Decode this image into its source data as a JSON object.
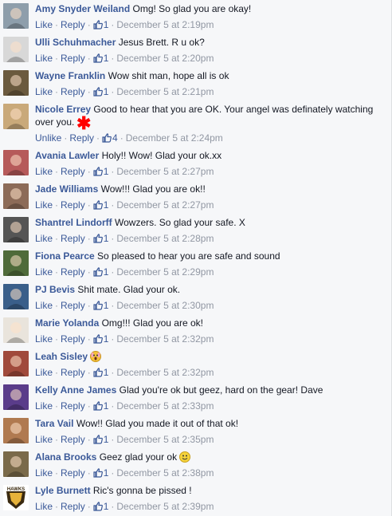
{
  "comments": [
    {
      "name": "Amy Snyder Weiland",
      "text": "Omg! So glad you are okay!",
      "like": "Like",
      "reply": "Reply",
      "likes": "1",
      "time": "December 5 at 2:19pm",
      "avatar_bg": "#8e9eab"
    },
    {
      "name": "Ulli Schuhmacher",
      "text": "Jesus Brett. R u ok?",
      "like": "Like",
      "reply": "Reply",
      "likes": "1",
      "time": "December 5 at 2:20pm",
      "avatar_bg": "#d8d8d8"
    },
    {
      "name": "Wayne Franklin",
      "text": "Wow shit man, hope all is ok",
      "like": "Like",
      "reply": "Reply",
      "likes": "1",
      "time": "December 5 at 2:21pm",
      "avatar_bg": "#6b5a3e"
    },
    {
      "name": "Nicole Errey",
      "text": "Good to hear that you are OK. Your angel was definately watching over you.",
      "like": "Unlike",
      "reply": "Reply",
      "likes": "4",
      "time": "December 5 at 2:24pm",
      "avatar_bg": "#c9a97a"
    },
    {
      "name": "Avania Lawler",
      "text": "Holy!! Wow! Glad your ok.xx",
      "like": "Like",
      "reply": "Reply",
      "likes": "1",
      "time": "December 5 at 2:27pm",
      "avatar_bg": "#b65a5a"
    },
    {
      "name": "Jade Williams",
      "text": "Wow!!! Glad you are ok!!",
      "like": "Like",
      "reply": "Reply",
      "likes": "1",
      "time": "December 5 at 2:27pm",
      "avatar_bg": "#8c6b58"
    },
    {
      "name": "Shantrel Lindorff",
      "text": "Wowzers. So glad your safe. X",
      "like": "Like",
      "reply": "Reply",
      "likes": "1",
      "time": "December 5 at 2:28pm",
      "avatar_bg": "#555555"
    },
    {
      "name": "Fiona Pearce",
      "text": "So pleased to hear you are safe and sound",
      "like": "Like",
      "reply": "Reply",
      "likes": "1",
      "time": "December 5 at 2:29pm",
      "avatar_bg": "#4f6b3a"
    },
    {
      "name": "PJ Bevis",
      "text": "Shit mate. Glad your ok.",
      "like": "Like",
      "reply": "Reply",
      "likes": "1",
      "time": "December 5 at 2:30pm",
      "avatar_bg": "#3a5f8a"
    },
    {
      "name": "Marie Yolanda",
      "text": "Omg!!! Glad you are ok!",
      "like": "Like",
      "reply": "Reply",
      "likes": "1",
      "time": "December 5 at 2:32pm",
      "avatar_bg": "#e9e4dc"
    },
    {
      "name": "Leah Sisley",
      "text": "",
      "like": "Like",
      "reply": "Reply",
      "likes": "1",
      "time": "December 5 at 2:32pm",
      "avatar_bg": "#a04a3c",
      "emoji": "scream"
    },
    {
      "name": "Kelly Anne James",
      "text": "Glad you're ok but geez, hard on the gear! Dave",
      "like": "Like",
      "reply": "Reply",
      "likes": "1",
      "time": "December 5 at 2:33pm",
      "avatar_bg": "#5a3c8a"
    },
    {
      "name": "Tara Vail",
      "text": "Wow!! Glad you made it out of that ok!",
      "like": "Like",
      "reply": "Reply",
      "likes": "1",
      "time": "December 5 at 2:35pm",
      "avatar_bg": "#b07a50"
    },
    {
      "name": "Alana Brooks",
      "text": "Geez glad your ok",
      "like": "Like",
      "reply": "Reply",
      "likes": "1",
      "time": "December 5 at 2:38pm",
      "avatar_bg": "#7a6a4a",
      "emoji": "smile"
    },
    {
      "name": "Lyle Burnett",
      "text": "Ric's gonna be pissed !",
      "like": "Like",
      "reply": "Reply",
      "likes": "1",
      "time": "December 5 at 2:39pm",
      "avatar_bg": "#3a2a10",
      "avatar_label": "HAWKS"
    }
  ],
  "colors": {
    "link": "#3b5998",
    "meta": "#9197a3",
    "annotation": "#ff0000"
  },
  "annotation_mark": "✱"
}
